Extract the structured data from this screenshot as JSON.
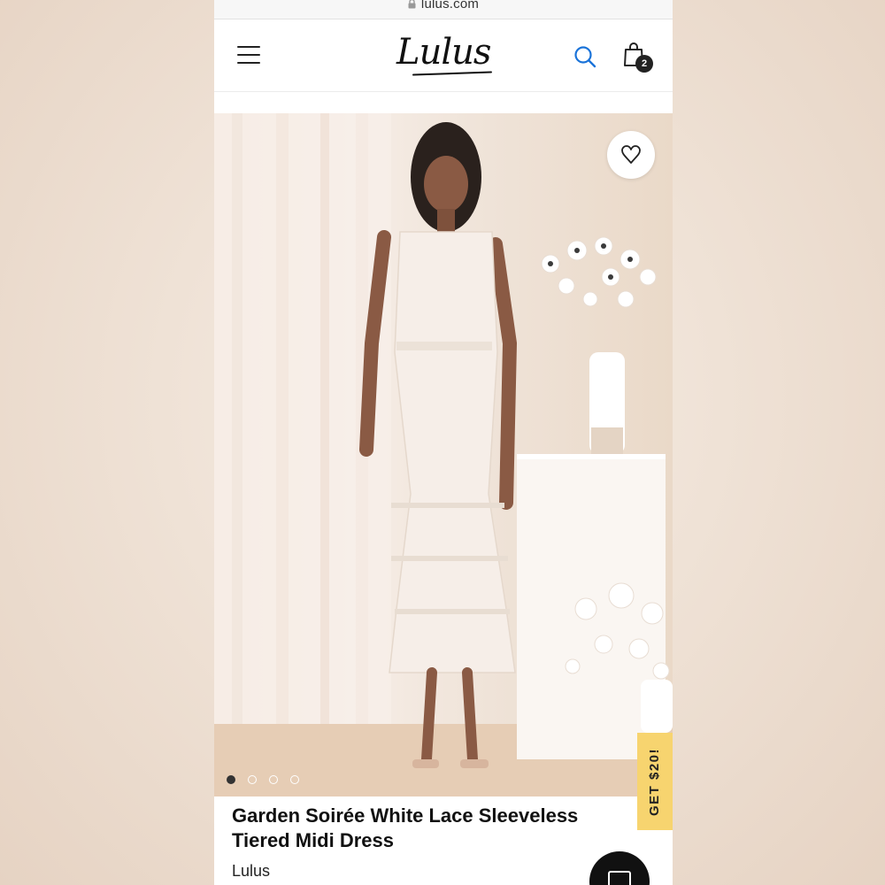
{
  "browser": {
    "url": "lulus.com",
    "lock_icon": "lock-icon"
  },
  "header": {
    "logo_text": "Lulus",
    "menu_icon": "hamburger-menu-icon",
    "search_icon": "search-icon",
    "bag_icon": "shopping-bag-icon",
    "bag_count": "2",
    "accent_color": "#1a73d9"
  },
  "gallery": {
    "wishlist_icon": "heart-icon",
    "slide_count": 4,
    "active_slide": 1
  },
  "promo": {
    "label": "GET $20!",
    "color": "#f7d46f"
  },
  "product": {
    "title": "Garden Soirée White Lace Sleeveless Tiered Midi Dress",
    "brand": "Lulus"
  },
  "chat": {
    "icon": "chat-icon"
  }
}
